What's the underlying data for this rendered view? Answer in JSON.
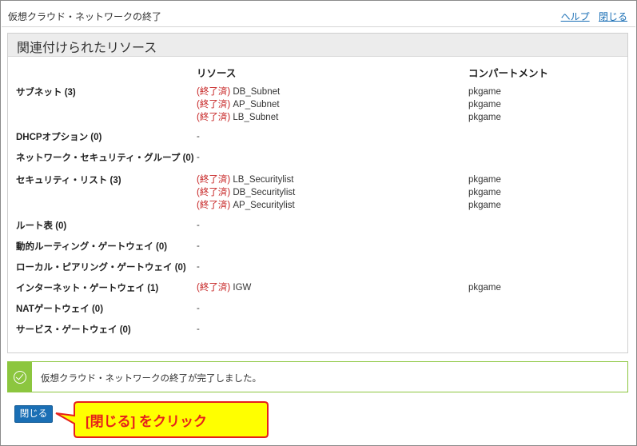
{
  "window": {
    "title": "仮想クラウド・ネットワークの終了",
    "help_link": "ヘルプ",
    "close_link": "閉じる"
  },
  "panel": {
    "heading": "関連付けられたリソース",
    "col_resource": "リソース",
    "col_compartment": "コンパートメント",
    "rows": [
      {
        "label": "サブネット (3)",
        "resources": [
          {
            "status": "(終了済)",
            "name": "DB_Subnet",
            "compartment": "pkgame"
          },
          {
            "status": "(終了済)",
            "name": "AP_Subnet",
            "compartment": "pkgame"
          },
          {
            "status": "(終了済)",
            "name": "LB_Subnet",
            "compartment": "pkgame"
          }
        ]
      },
      {
        "label": "DHCPオプション (0)",
        "empty": "-"
      },
      {
        "label": "ネットワーク・セキュリティ・グループ (0)",
        "empty": "-"
      },
      {
        "label": "セキュリティ・リスト (3)",
        "resources": [
          {
            "status": "(終了済)",
            "name": "LB_Securitylist",
            "compartment": "pkgame"
          },
          {
            "status": "(終了済)",
            "name": "DB_Securitylist",
            "compartment": "pkgame"
          },
          {
            "status": "(終了済)",
            "name": "AP_Securitylist",
            "compartment": "pkgame"
          }
        ]
      },
      {
        "label": "ルート表 (0)",
        "empty": "-"
      },
      {
        "label": "動的ルーティング・ゲートウェイ (0)",
        "empty": "-"
      },
      {
        "label": "ローカル・ピアリング・ゲートウェイ (0)",
        "empty": "-"
      },
      {
        "label": "インターネット・ゲートウェイ (1)",
        "resources": [
          {
            "status": "(終了済)",
            "name": "IGW",
            "compartment": "pkgame"
          }
        ]
      },
      {
        "label": "NATゲートウェイ (0)",
        "empty": "-"
      },
      {
        "label": "サービス・ゲートウェイ (0)",
        "empty": "-"
      }
    ]
  },
  "success": {
    "icon": "check-circle-icon",
    "message": "仮想クラウド・ネットワークの終了が完了しました。"
  },
  "footer": {
    "close_button": "閉じる"
  },
  "callout": {
    "text": "[閉じる] をクリック"
  },
  "colors": {
    "accent": "#1a6fb5",
    "terminated": "#c51f1f",
    "success": "#8cc63f",
    "callout_fill": "#ffff00",
    "callout_border": "#e6201b"
  }
}
